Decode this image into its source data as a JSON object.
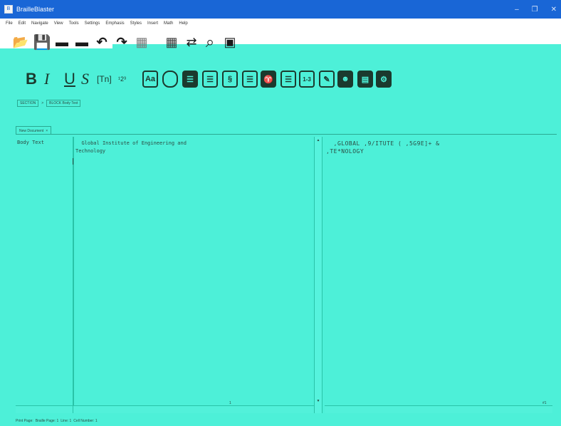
{
  "window": {
    "title": "BrailleBlaster",
    "app_icon_glyph": "B",
    "minimize_glyph": "–",
    "maximize_glyph": "❐",
    "close_glyph": "✕"
  },
  "menu": {
    "items": [
      "File",
      "Edit",
      "Navigate",
      "View",
      "Tools",
      "Settings",
      "Emphasis",
      "Styles",
      "Insert",
      "Math",
      "Help"
    ]
  },
  "toolbar_main": {
    "icons": [
      {
        "name": "open-icon",
        "glyph": "📂"
      },
      {
        "name": "save-icon",
        "glyph": "💾"
      },
      {
        "name": "print-icon",
        "glyph": "▬"
      },
      {
        "name": "emboss-icon",
        "glyph": "▬"
      },
      {
        "name": "undo-icon",
        "glyph": "↶"
      },
      {
        "name": "redo-icon",
        "glyph": "↷"
      },
      {
        "name": "image-icon",
        "glyph": "▦"
      },
      {
        "name": "table-icon",
        "glyph": "▦"
      },
      {
        "name": "translate-icon",
        "glyph": "⇄"
      },
      {
        "name": "find-icon",
        "glyph": "⌕"
      },
      {
        "name": "preview-icon",
        "glyph": "▣"
      }
    ]
  },
  "toolbar_format": {
    "bold_label": "B",
    "italic_label": "I",
    "underline_label": "U",
    "script_label": "S",
    "tn_label": "[Tn]",
    "superscript_label": "¹2³",
    "aa_label": "Aa"
  },
  "breadcrumb": {
    "section": "SECTION",
    "separator": ">",
    "block": "BLOCK Body Text"
  },
  "tab": {
    "label": "New Document",
    "close": "×"
  },
  "editor": {
    "style_name": "Body Text",
    "print_text": "  Global Institute of Engineering and\nTechnology",
    "braille_text": "  ,GLOBAL ,9/ITUTE ( ,5G9E]+ & \n,TE*NOLOGY",
    "print_mark": "1",
    "braille_mark": "#1"
  },
  "statusbar": {
    "print_page": "Print Page:",
    "braille_page": "Braille Page: 1",
    "line": "Line: 1",
    "cell": "Cell Number: 1"
  },
  "colors": {
    "background": "#4df0d8",
    "titlebar": "#1966d6"
  }
}
